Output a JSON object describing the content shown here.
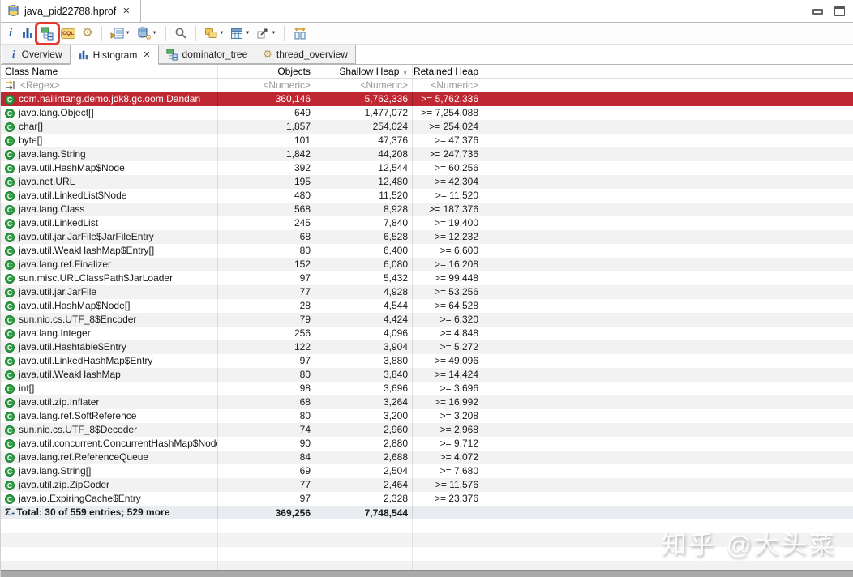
{
  "window": {
    "editor_tab_label": "java_pid22788.hprof"
  },
  "icons": {
    "close": "✕",
    "dropdown": "▼",
    "info": "i",
    "class_letter": "C",
    "sigma": "Σ",
    "sigma_plus": "+",
    "sort_desc": "∨",
    "oql_label": "OQL"
  },
  "toolbar": {
    "buttons": [
      "info",
      "histogram",
      "dominator-tree",
      "oql",
      "thread-overview-gear",
      "query-browser",
      "heap-dump-settings",
      "search",
      "group-result",
      "calculate-retained-size",
      "export",
      "compare-tables"
    ],
    "annotation": "red-box-around-dominator-tree-button"
  },
  "view_tabs": [
    {
      "label": "Overview",
      "icon": "info-icon",
      "active": false,
      "closable": false
    },
    {
      "label": "Histogram",
      "icon": "histogram-icon",
      "active": true,
      "closable": true
    },
    {
      "label": "dominator_tree",
      "icon": "dominator-tree-icon",
      "active": false,
      "closable": false
    },
    {
      "label": "thread_overview",
      "icon": "gear-icon",
      "active": false,
      "closable": false
    }
  ],
  "table": {
    "columns": [
      "Class Name",
      "Objects",
      "Shallow Heap",
      "Retained Heap"
    ],
    "sorted_column": "Shallow Heap",
    "filter_row": {
      "name": "<Regex>",
      "objects": "<Numeric>",
      "shallow": "<Numeric>",
      "retained": "<Numeric>"
    },
    "rows": [
      {
        "name": "com.hailintang.demo.jdk8.gc.oom.Dandan",
        "objects": "360,146",
        "shallow": "5,762,336",
        "retained": ">= 5,762,336",
        "selected": true
      },
      {
        "name": "java.lang.Object[]",
        "objects": "649",
        "shallow": "1,477,072",
        "retained": ">= 7,254,088"
      },
      {
        "name": "char[]",
        "objects": "1,857",
        "shallow": "254,024",
        "retained": ">= 254,024"
      },
      {
        "name": "byte[]",
        "objects": "101",
        "shallow": "47,376",
        "retained": ">= 47,376"
      },
      {
        "name": "java.lang.String",
        "objects": "1,842",
        "shallow": "44,208",
        "retained": ">= 247,736"
      },
      {
        "name": "java.util.HashMap$Node",
        "objects": "392",
        "shallow": "12,544",
        "retained": ">= 60,256"
      },
      {
        "name": "java.net.URL",
        "objects": "195",
        "shallow": "12,480",
        "retained": ">= 42,304"
      },
      {
        "name": "java.util.LinkedList$Node",
        "objects": "480",
        "shallow": "11,520",
        "retained": ">= 11,520"
      },
      {
        "name": "java.lang.Class",
        "objects": "568",
        "shallow": "8,928",
        "retained": ">= 187,376"
      },
      {
        "name": "java.util.LinkedList",
        "objects": "245",
        "shallow": "7,840",
        "retained": ">= 19,400"
      },
      {
        "name": "java.util.jar.JarFile$JarFileEntry",
        "objects": "68",
        "shallow": "6,528",
        "retained": ">= 12,232"
      },
      {
        "name": "java.util.WeakHashMap$Entry[]",
        "objects": "80",
        "shallow": "6,400",
        "retained": ">= 6,600"
      },
      {
        "name": "java.lang.ref.Finalizer",
        "objects": "152",
        "shallow": "6,080",
        "retained": ">= 16,208"
      },
      {
        "name": "sun.misc.URLClassPath$JarLoader",
        "objects": "97",
        "shallow": "5,432",
        "retained": ">= 99,448"
      },
      {
        "name": "java.util.jar.JarFile",
        "objects": "77",
        "shallow": "4,928",
        "retained": ">= 53,256"
      },
      {
        "name": "java.util.HashMap$Node[]",
        "objects": "28",
        "shallow": "4,544",
        "retained": ">= 64,528"
      },
      {
        "name": "sun.nio.cs.UTF_8$Encoder",
        "objects": "79",
        "shallow": "4,424",
        "retained": ">= 6,320"
      },
      {
        "name": "java.lang.Integer",
        "objects": "256",
        "shallow": "4,096",
        "retained": ">= 4,848"
      },
      {
        "name": "java.util.Hashtable$Entry",
        "objects": "122",
        "shallow": "3,904",
        "retained": ">= 5,272"
      },
      {
        "name": "java.util.LinkedHashMap$Entry",
        "objects": "97",
        "shallow": "3,880",
        "retained": ">= 49,096"
      },
      {
        "name": "java.util.WeakHashMap",
        "objects": "80",
        "shallow": "3,840",
        "retained": ">= 14,424"
      },
      {
        "name": "int[]",
        "objects": "98",
        "shallow": "3,696",
        "retained": ">= 3,696"
      },
      {
        "name": "java.util.zip.Inflater",
        "objects": "68",
        "shallow": "3,264",
        "retained": ">= 16,992"
      },
      {
        "name": "java.lang.ref.SoftReference",
        "objects": "80",
        "shallow": "3,200",
        "retained": ">= 3,208"
      },
      {
        "name": "sun.nio.cs.UTF_8$Decoder",
        "objects": "74",
        "shallow": "2,960",
        "retained": ">= 2,968"
      },
      {
        "name": "java.util.concurrent.ConcurrentHashMap$Node",
        "objects": "90",
        "shallow": "2,880",
        "retained": ">= 9,712"
      },
      {
        "name": "java.lang.ref.ReferenceQueue",
        "objects": "84",
        "shallow": "2,688",
        "retained": ">= 4,072"
      },
      {
        "name": "java.lang.String[]",
        "objects": "69",
        "shallow": "2,504",
        "retained": ">= 7,680"
      },
      {
        "name": "java.util.zip.ZipCoder",
        "objects": "77",
        "shallow": "2,464",
        "retained": ">= 11,576"
      },
      {
        "name": "java.io.ExpiringCache$Entry",
        "objects": "97",
        "shallow": "2,328",
        "retained": ">= 23,376"
      }
    ],
    "total": {
      "label": "Total: 30 of 559 entries; 529 more",
      "objects": "369,256",
      "shallow": "7,748,544",
      "retained": ""
    }
  },
  "watermark": "知乎 @大头菜",
  "colors": {
    "selection": "#bf2833",
    "alt_row": "#f2f2f3",
    "annotation_red": "#e23a30",
    "class_icon_green": "#2f9e45"
  }
}
